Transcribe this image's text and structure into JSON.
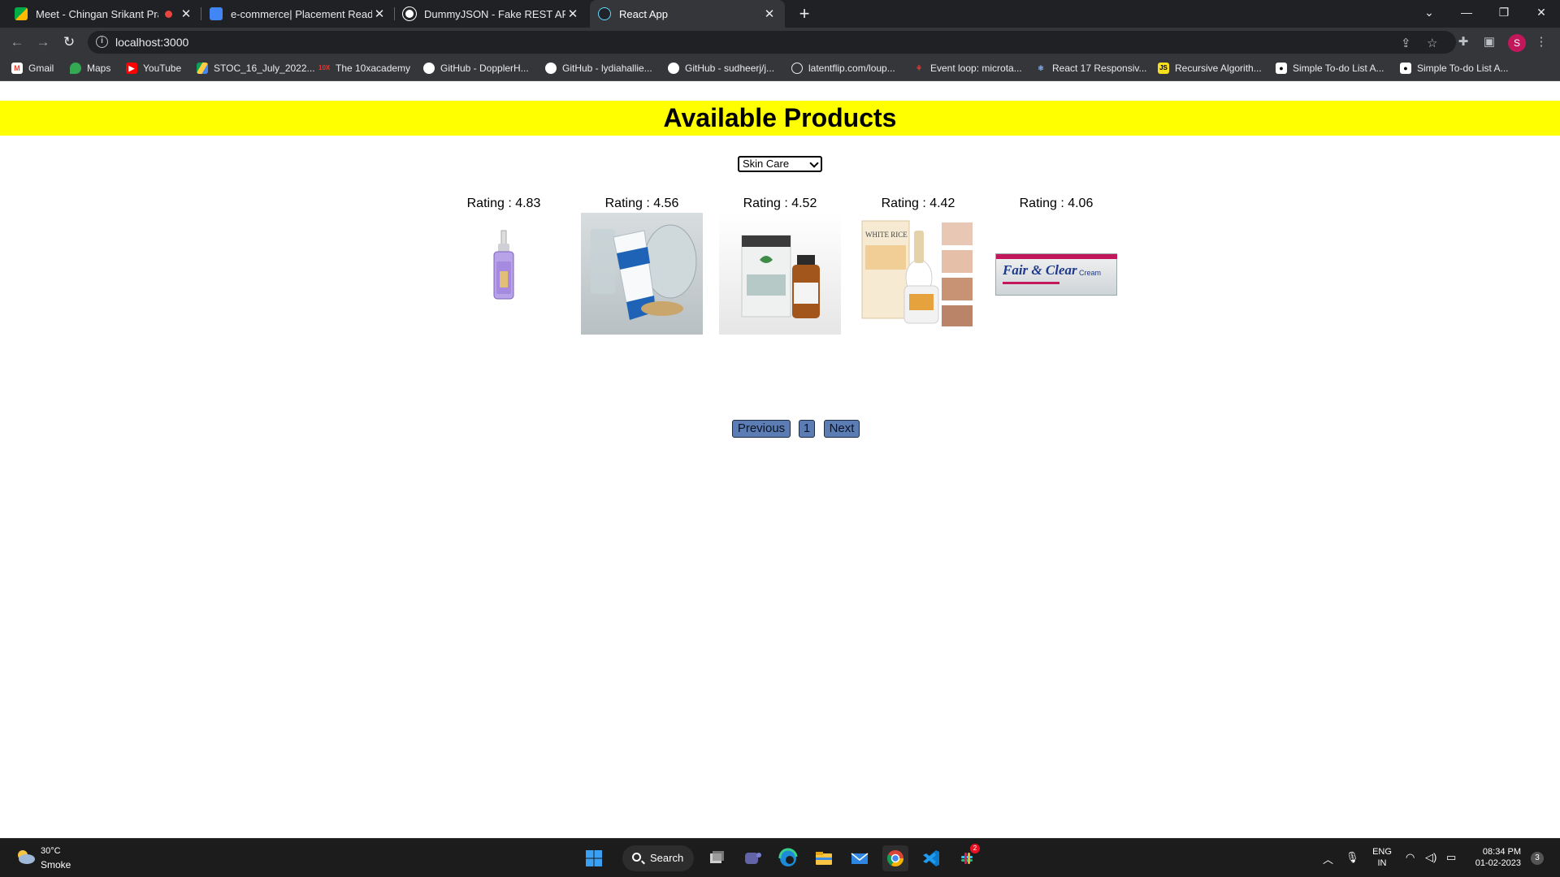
{
  "browser": {
    "tabs": [
      {
        "title": "Meet - Chingan Srikant Prakash",
        "favicon": "google-meet-icon",
        "recording": true
      },
      {
        "title": "e-commerce| Placement Readiness",
        "favicon": "google-docs-icon"
      },
      {
        "title": "DummyJSON - Fake REST API of JSON",
        "favicon": "dummyjson-icon"
      },
      {
        "title": "React App",
        "favicon": "react-icon",
        "active": true
      }
    ],
    "new_tab_symbol": "+",
    "url": "localhost:3000",
    "profile_initial": "S",
    "bookmarks": [
      {
        "label": "Gmail",
        "icon": "gmail-icon"
      },
      {
        "label": "Maps",
        "icon": "maps-icon"
      },
      {
        "label": "YouTube",
        "icon": "youtube-icon"
      },
      {
        "label": "STOC_16_July_2022...",
        "icon": "drive-icon"
      },
      {
        "label": "The 10xacademy",
        "icon": "10x-icon"
      },
      {
        "label": "GitHub - DopplerH...",
        "icon": "github-icon"
      },
      {
        "label": "GitHub - lydiahallie...",
        "icon": "github-icon"
      },
      {
        "label": "GitHub - sudheerj/j...",
        "icon": "github-icon"
      },
      {
        "label": "latentflip.com/loup...",
        "icon": "globe-icon"
      },
      {
        "label": "Event loop: microta...",
        "icon": "javascript-info-icon"
      },
      {
        "label": "React 17 Responsiv...",
        "icon": "react-icon"
      },
      {
        "label": "Recursive Algorith...",
        "icon": "js-icon"
      },
      {
        "label": "Simple To-do List A...",
        "icon": "medium-icon"
      },
      {
        "label": "Simple To-do List A...",
        "icon": "medium-icon"
      }
    ]
  },
  "page": {
    "heading": "Available Products",
    "category": {
      "selected": "Skin Care"
    },
    "products": [
      {
        "rating_text": "Rating : 4.83",
        "image": "purple-serum-bottle"
      },
      {
        "rating_text": "Rating : 4.56",
        "image": "blue-white-cream-tube"
      },
      {
        "rating_text": "Rating : 4.52",
        "image": "tea-tree-oil-bottle"
      },
      {
        "rating_text": "Rating : 4.42",
        "image": "white-rice-serum-set"
      },
      {
        "rating_text": "Rating : 4.06",
        "image": "fair-and-clear-cream-box"
      }
    ],
    "product_label_text": {
      "fair_clear": "Fair & Clear",
      "cream": "Cream",
      "white_rice": "WHITE RICE"
    },
    "pagination": {
      "previous": "Previous",
      "page": "1",
      "next": "Next"
    }
  },
  "taskbar": {
    "weather": {
      "temp": "30°C",
      "condition": "Smoke"
    },
    "search_label": "Search",
    "language": {
      "line1": "ENG",
      "line2": "IN"
    },
    "time": "08:34 PM",
    "date": "01-02-2023",
    "notifications": "3",
    "slack_badge": "2"
  }
}
